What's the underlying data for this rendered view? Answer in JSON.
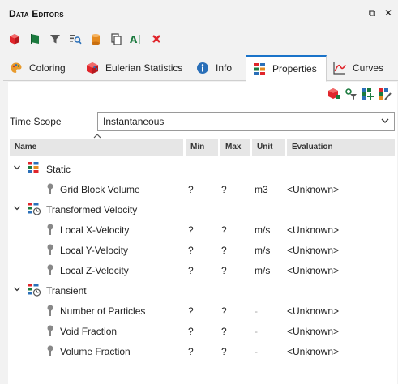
{
  "window": {
    "title": "Data Editors",
    "float_glyph": "⧉",
    "close_glyph": "✕"
  },
  "toolbar": {
    "buttons": [
      {
        "name": "cube-icon",
        "color": "#e0252b"
      },
      {
        "name": "flag-icon",
        "color": "#1b7a3e"
      },
      {
        "name": "filter-icon",
        "color": "#555555"
      },
      {
        "name": "search-list-icon",
        "color": "#555555"
      },
      {
        "name": "database-icon",
        "color": "#e58a1f"
      },
      {
        "name": "copy-icon",
        "color": "#444444"
      },
      {
        "name": "text-cursor-icon",
        "color": "#1b7a3e"
      },
      {
        "name": "delete-icon",
        "color": "#e0252b"
      }
    ]
  },
  "tabs": [
    {
      "label": "Coloring",
      "icon": "palette-icon",
      "active": false
    },
    {
      "label": "Eulerian Statistics",
      "icon": "cube-grid-icon",
      "active": false
    },
    {
      "label": "Info",
      "icon": "info-icon",
      "active": false
    },
    {
      "label": "Properties",
      "icon": "properties-icon",
      "active": true
    },
    {
      "label": "Curves",
      "icon": "curve-icon",
      "active": false
    }
  ],
  "time_scope": {
    "label": "Time Scope",
    "value": "Instantaneous"
  },
  "columns": [
    "Name",
    "Min",
    "Max",
    "Unit",
    "Evaluation"
  ],
  "groups": [
    {
      "name": "Static",
      "rows": [
        {
          "name": "Grid Block Volume",
          "min": "?",
          "max": "?",
          "unit": "m3",
          "evaluation": "<Unknown>"
        }
      ]
    },
    {
      "name": "Transformed Velocity",
      "rows": [
        {
          "name": "Local X-Velocity",
          "min": "?",
          "max": "?",
          "unit": "m/s",
          "evaluation": "<Unknown>"
        },
        {
          "name": "Local Y-Velocity",
          "min": "?",
          "max": "?",
          "unit": "m/s",
          "evaluation": "<Unknown>"
        },
        {
          "name": "Local Z-Velocity",
          "min": "?",
          "max": "?",
          "unit": "m/s",
          "evaluation": "<Unknown>"
        }
      ]
    },
    {
      "name": "Transient",
      "rows": [
        {
          "name": "Number of Particles",
          "min": "?",
          "max": "?",
          "unit": "-",
          "evaluation": "<Unknown>"
        },
        {
          "name": "Void Fraction",
          "min": "?",
          "max": "?",
          "unit": "-",
          "evaluation": "<Unknown>"
        },
        {
          "name": "Volume Fraction",
          "min": "?",
          "max": "?",
          "unit": "-",
          "evaluation": "<Unknown>"
        }
      ]
    }
  ],
  "colors": {
    "accent": "#1a73c9",
    "header_bg": "#e6e6e6",
    "panel_bg": "#ffffff"
  }
}
